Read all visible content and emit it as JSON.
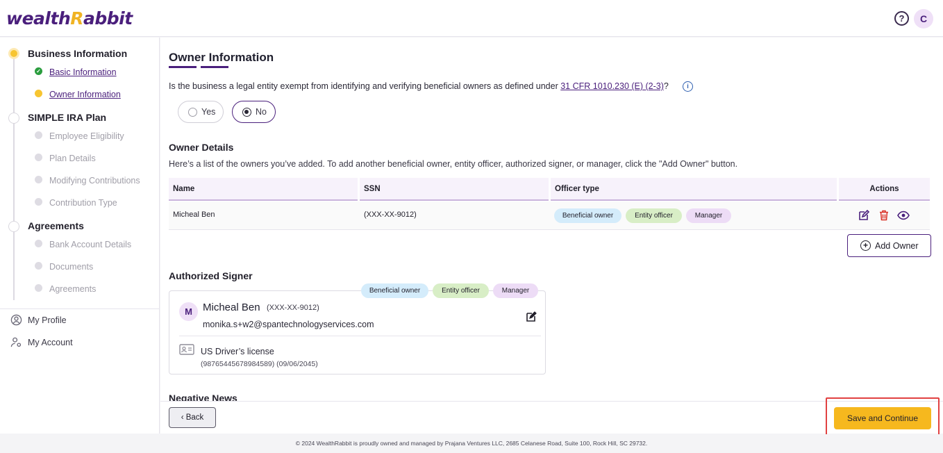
{
  "app": {
    "logo_wealth": "wealth",
    "logo_r": "R",
    "logo_rest": "abbit",
    "user_initial": "C"
  },
  "sidebar": {
    "steps": [
      {
        "label": "Business Information",
        "state": "active",
        "items": [
          {
            "label": "Basic Information",
            "state": "done"
          },
          {
            "label": "Owner Information",
            "state": "current"
          }
        ]
      },
      {
        "label": "SIMPLE IRA Plan",
        "state": "pending",
        "items": [
          {
            "label": "Employee Eligibility",
            "state": "pending"
          },
          {
            "label": "Plan Details",
            "state": "pending"
          },
          {
            "label": "Modifying Contributions",
            "state": "pending"
          },
          {
            "label": "Contribution Type",
            "state": "pending"
          }
        ]
      },
      {
        "label": "Agreements",
        "state": "pending",
        "items": [
          {
            "label": "Bank Account Details",
            "state": "pending"
          },
          {
            "label": "Documents",
            "state": "pending"
          },
          {
            "label": "Agreements",
            "state": "pending"
          }
        ]
      }
    ],
    "menu": [
      {
        "label": "My Profile",
        "icon": "user-circle-icon"
      },
      {
        "label": "My Account",
        "icon": "user-gear-icon"
      }
    ]
  },
  "main": {
    "title": "Owner Information",
    "question_prefix": "Is the business a legal entity exempt from identifying and verifying beneficial owners as defined under ",
    "question_link": "31 CFR 1010.230 (E) (2-3)",
    "question_suffix": "?",
    "radio_yes": "Yes",
    "radio_no": "No",
    "selected": "No",
    "owner_details_title": "Owner Details",
    "owner_details_desc": "Here’s a list of the owners you’ve added. To add another beneficial owner, entity officer, authorized signer, or manager, click the \"Add Owner\" button.",
    "table": {
      "headers": [
        "Name",
        "SSN",
        "Officer type",
        "Actions"
      ],
      "rows": [
        {
          "name": "Micheal Ben",
          "ssn": "(XXX-XX-9012)",
          "officer_types": [
            "Beneficial owner",
            "Entity officer",
            "Manager"
          ]
        }
      ]
    },
    "add_owner_label": "Add Owner",
    "authorized_signer_title": "Authorized Signer",
    "signer": {
      "initial": "M",
      "name": "Micheal Ben",
      "ssn": "(XXX-XX-9012)",
      "email": "monika.s+w2@spantechnologyservices.com",
      "badges": [
        "Beneficial owner",
        "Entity officer",
        "Manager"
      ],
      "id_type": "US Driver’s license",
      "id_detail": "(98765445678984589) (09/06/2045)"
    },
    "negative_news_title": "Negative News"
  },
  "actions": {
    "back_label": "Back",
    "save_label": "Save and Continue"
  },
  "footer": "© 2024 WealthRabbit is proudly owned and managed by Prajana Ventures LLC, 2685 Celanese Road, Suite 100, Rock Hill, SC 29732.",
  "colors": {
    "brand": "#4a1f7c",
    "accent": "#f6b81e",
    "highlight": "#e14141"
  }
}
